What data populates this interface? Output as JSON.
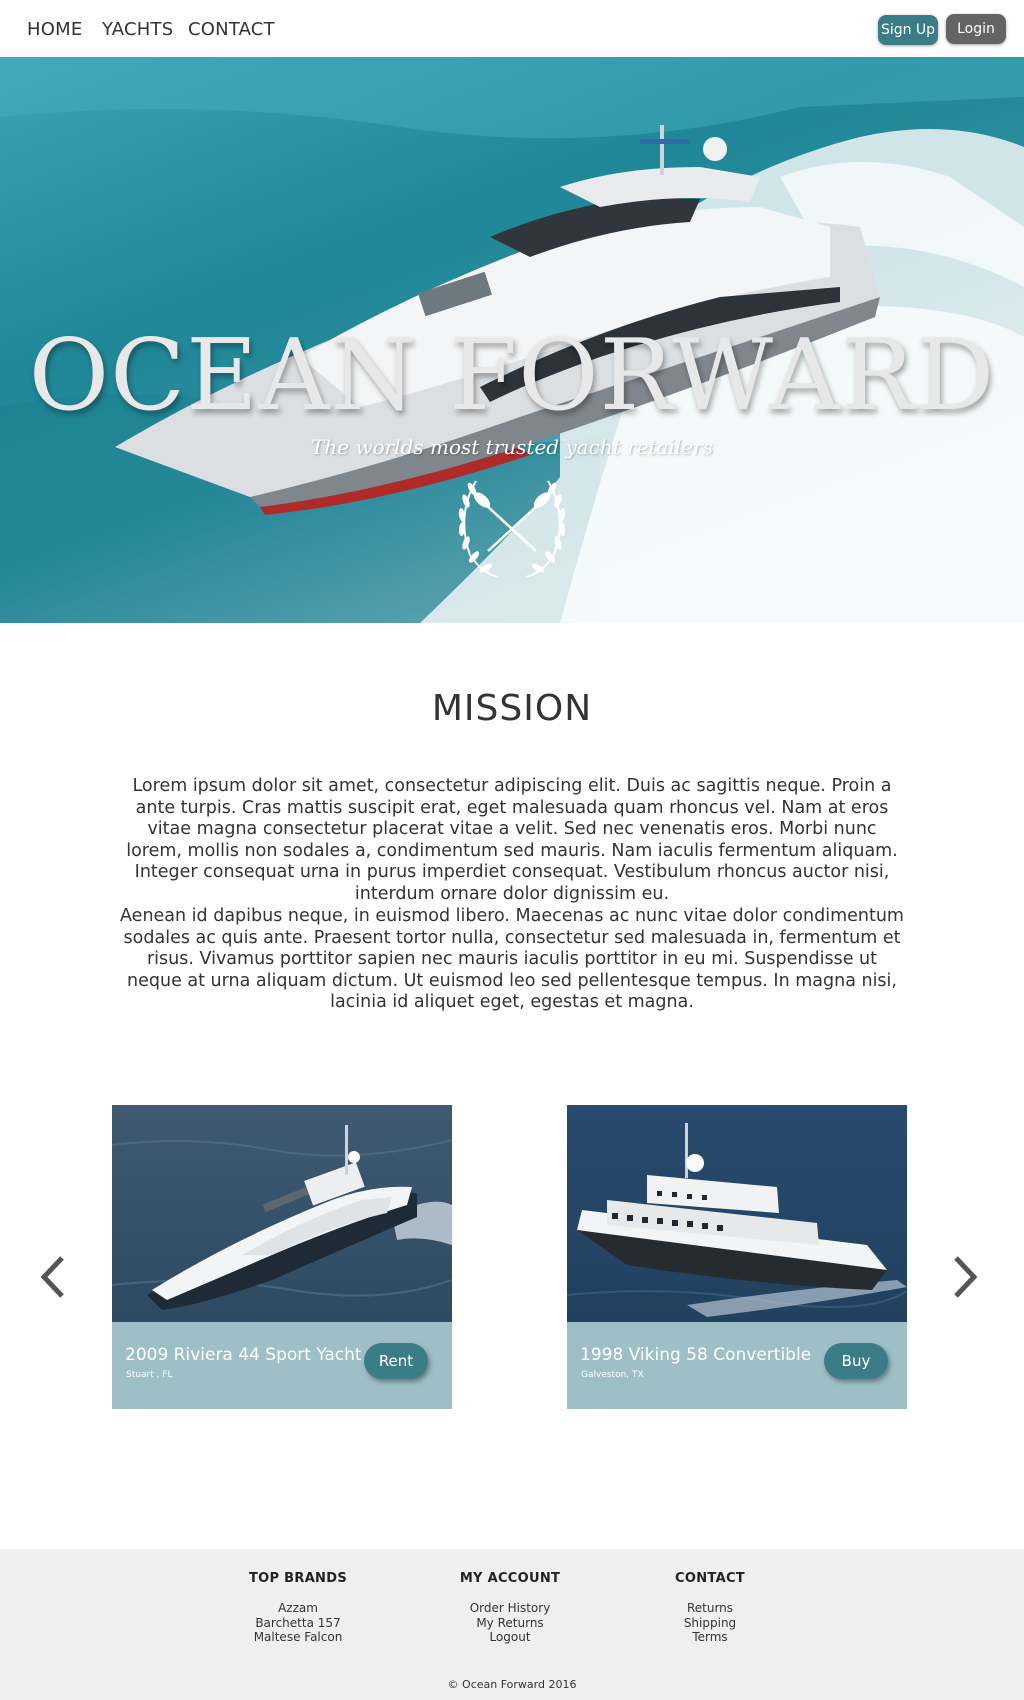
{
  "nav": {
    "links": [
      "HOME",
      "YACHTS",
      "CONTACT"
    ],
    "signup": "Sign Up",
    "login": "Login"
  },
  "hero": {
    "title": "OCEAN FORWARD",
    "subtitle": "The worlds most trusted yacht retailers",
    "emblem": "crossed-oars-laurel-icon"
  },
  "mission": {
    "title": "MISSION",
    "paragraphs": [
      "Lorem ipsum dolor sit amet, consectetur adipiscing elit. Duis ac sagittis neque. Proin a ante turpis. Cras mattis suscipit erat, eget malesuada quam rhoncus vel. Nam at eros vitae magna consectetur placerat vitae a velit. Sed nec venenatis eros. Morbi nunc lorem, mollis non sodales a, condimentum sed mauris. Nam iaculis fermentum aliquam. Integer consequat urna in purus imperdiet consequat. Vestibulum rhoncus auctor nisi, interdum ornare dolor dignissim eu.",
      "Aenean id dapibus neque, in euismod libero. Maecenas ac nunc vitae dolor condimentum sodales ac quis ante. Praesent tortor nulla, consectetur sed malesuada in, fermentum et risus. Vivamus porttitor sapien nec mauris iaculis porttitor in eu mi. Suspendisse ut neque at urna aliquam dictum. Ut euismod leo sed pellentesque tempus. In magna nisi, lacinia id aliquet eget, egestas et magna."
    ]
  },
  "listings": [
    {
      "title": "2009 Riviera 44 Sport Yacht",
      "location": "Stuart , FL",
      "action": "Rent"
    },
    {
      "title": "1998 Viking 58 Convertible",
      "location": "Galveston, TX",
      "action": "Buy"
    }
  ],
  "carousel": {
    "prev_icon": "chevron-left-icon",
    "next_icon": "chevron-right-icon"
  },
  "footer": {
    "columns": [
      {
        "heading": "TOP BRANDS",
        "items": [
          "Azzam",
          "Barchetta 157",
          "Maltese Falcon"
        ]
      },
      {
        "heading": "MY ACCOUNT",
        "items": [
          "Order History",
          "My Returns",
          "Logout"
        ]
      },
      {
        "heading": "CONTACT",
        "items": [
          "Returns",
          "Shipping",
          "Terms"
        ]
      }
    ],
    "copyright": "© Ocean Forward 2016"
  },
  "colors": {
    "accent": "#3a7d87",
    "login": "#646464",
    "card_info": "#9dbfc5",
    "footer_bg": "#efefef"
  }
}
